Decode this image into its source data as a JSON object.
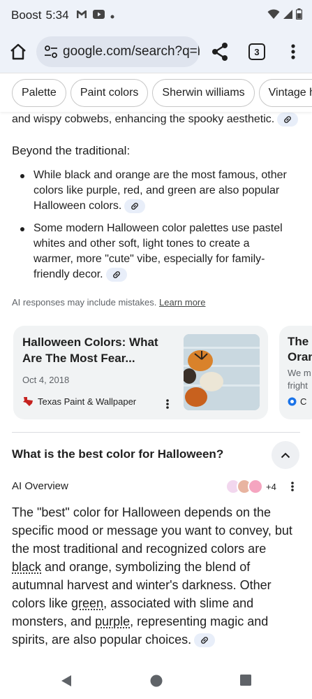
{
  "status": {
    "carrier": "Boost",
    "time": "5:34"
  },
  "browser": {
    "url": "google.com/search?q=h",
    "tab_count": "3"
  },
  "chips": [
    "Palette",
    "Paint colors",
    "Sherwin williams",
    "Vintage ha"
  ],
  "content": {
    "top_text": "and wispy cobwebs, enhancing the spooky aesthetic.",
    "beyond_heading": "Beyond the traditional:",
    "bullets": [
      "While black and orange are the most famous, other colors like purple, red, and green are also popular Halloween colors.",
      "Some modern Halloween color palettes use pastel whites and other soft, light tones to create a warmer, more \"cute\" vibe, especially for family-friendly decor."
    ],
    "disclaimer": "AI responses may include mistakes.",
    "learn_more": "Learn more"
  },
  "cards": [
    {
      "title": "Halloween Colors: What Are The Most Fear...",
      "date": "Oct 4, 2018",
      "source": "Texas Paint & Wallpaper"
    },
    {
      "title": "The Oran",
      "snippet": "We m fright",
      "source": "C"
    }
  ],
  "faq": {
    "question": "What is the best color for Halloween?",
    "ai_label": "AI Overview",
    "source_count": "+4",
    "answer_parts": [
      "The \"best\" color for Halloween depends on the specific mood or message you want to convey, but the most traditional and recognized colors are ",
      "black",
      " and orange, symbolizing the blend of autumnal harvest and winter's darkness. Other colors like ",
      "green",
      ", associated with slime and monsters, and ",
      "purple",
      ", representing magic and spirits, are also popular choices."
    ]
  },
  "colors": {
    "browser_bg": "#eef2f9",
    "omnibox_bg": "#dfe4ee",
    "card_bg": "#f1f3f4",
    "link_pill": "#e8eef9"
  },
  "icons": [
    "home-icon",
    "tune-icon",
    "share-icon",
    "tab-switcher-icon",
    "more-vert-icon",
    "link-icon",
    "chevron-up-icon",
    "back-triangle-icon",
    "home-circle-icon",
    "recents-square-icon"
  ]
}
